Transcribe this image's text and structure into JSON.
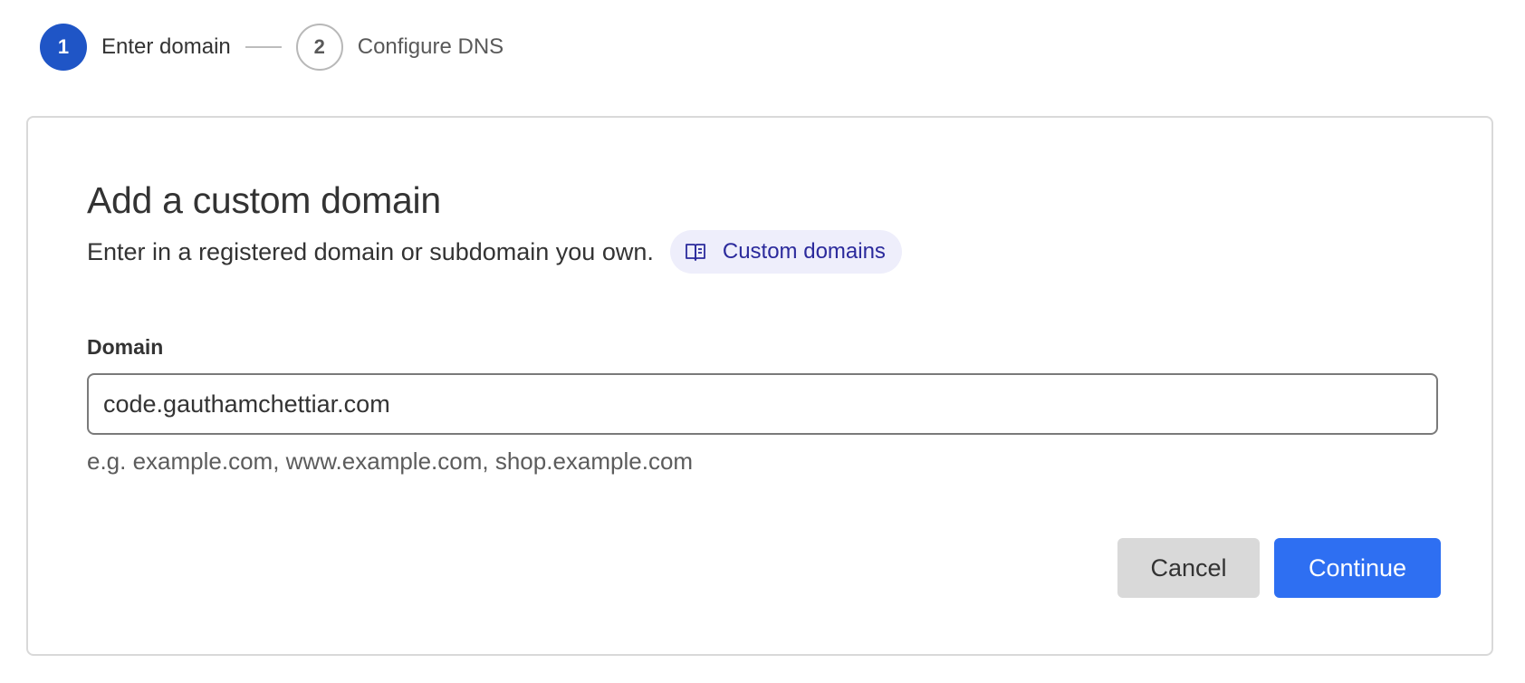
{
  "stepper": {
    "steps": [
      {
        "number": "1",
        "label": "Enter domain",
        "state": "active"
      },
      {
        "number": "2",
        "label": "Configure DNS",
        "state": "inactive"
      }
    ]
  },
  "form": {
    "title": "Add a custom domain",
    "subtitle": "Enter in a registered domain or subdomain you own.",
    "doc_link": {
      "label": "Custom domains",
      "icon": "book-icon"
    },
    "domain_field": {
      "label": "Domain",
      "value": "code.gauthamchettiar.com",
      "helper": "e.g. example.com, www.example.com, shop.example.com"
    },
    "actions": {
      "cancel_label": "Cancel",
      "continue_label": "Continue"
    }
  },
  "colors": {
    "primary": "#2e6ff2",
    "step_active": "#1f55c6",
    "link_bg": "#eeeefb",
    "link_text": "#2b2a9c"
  }
}
